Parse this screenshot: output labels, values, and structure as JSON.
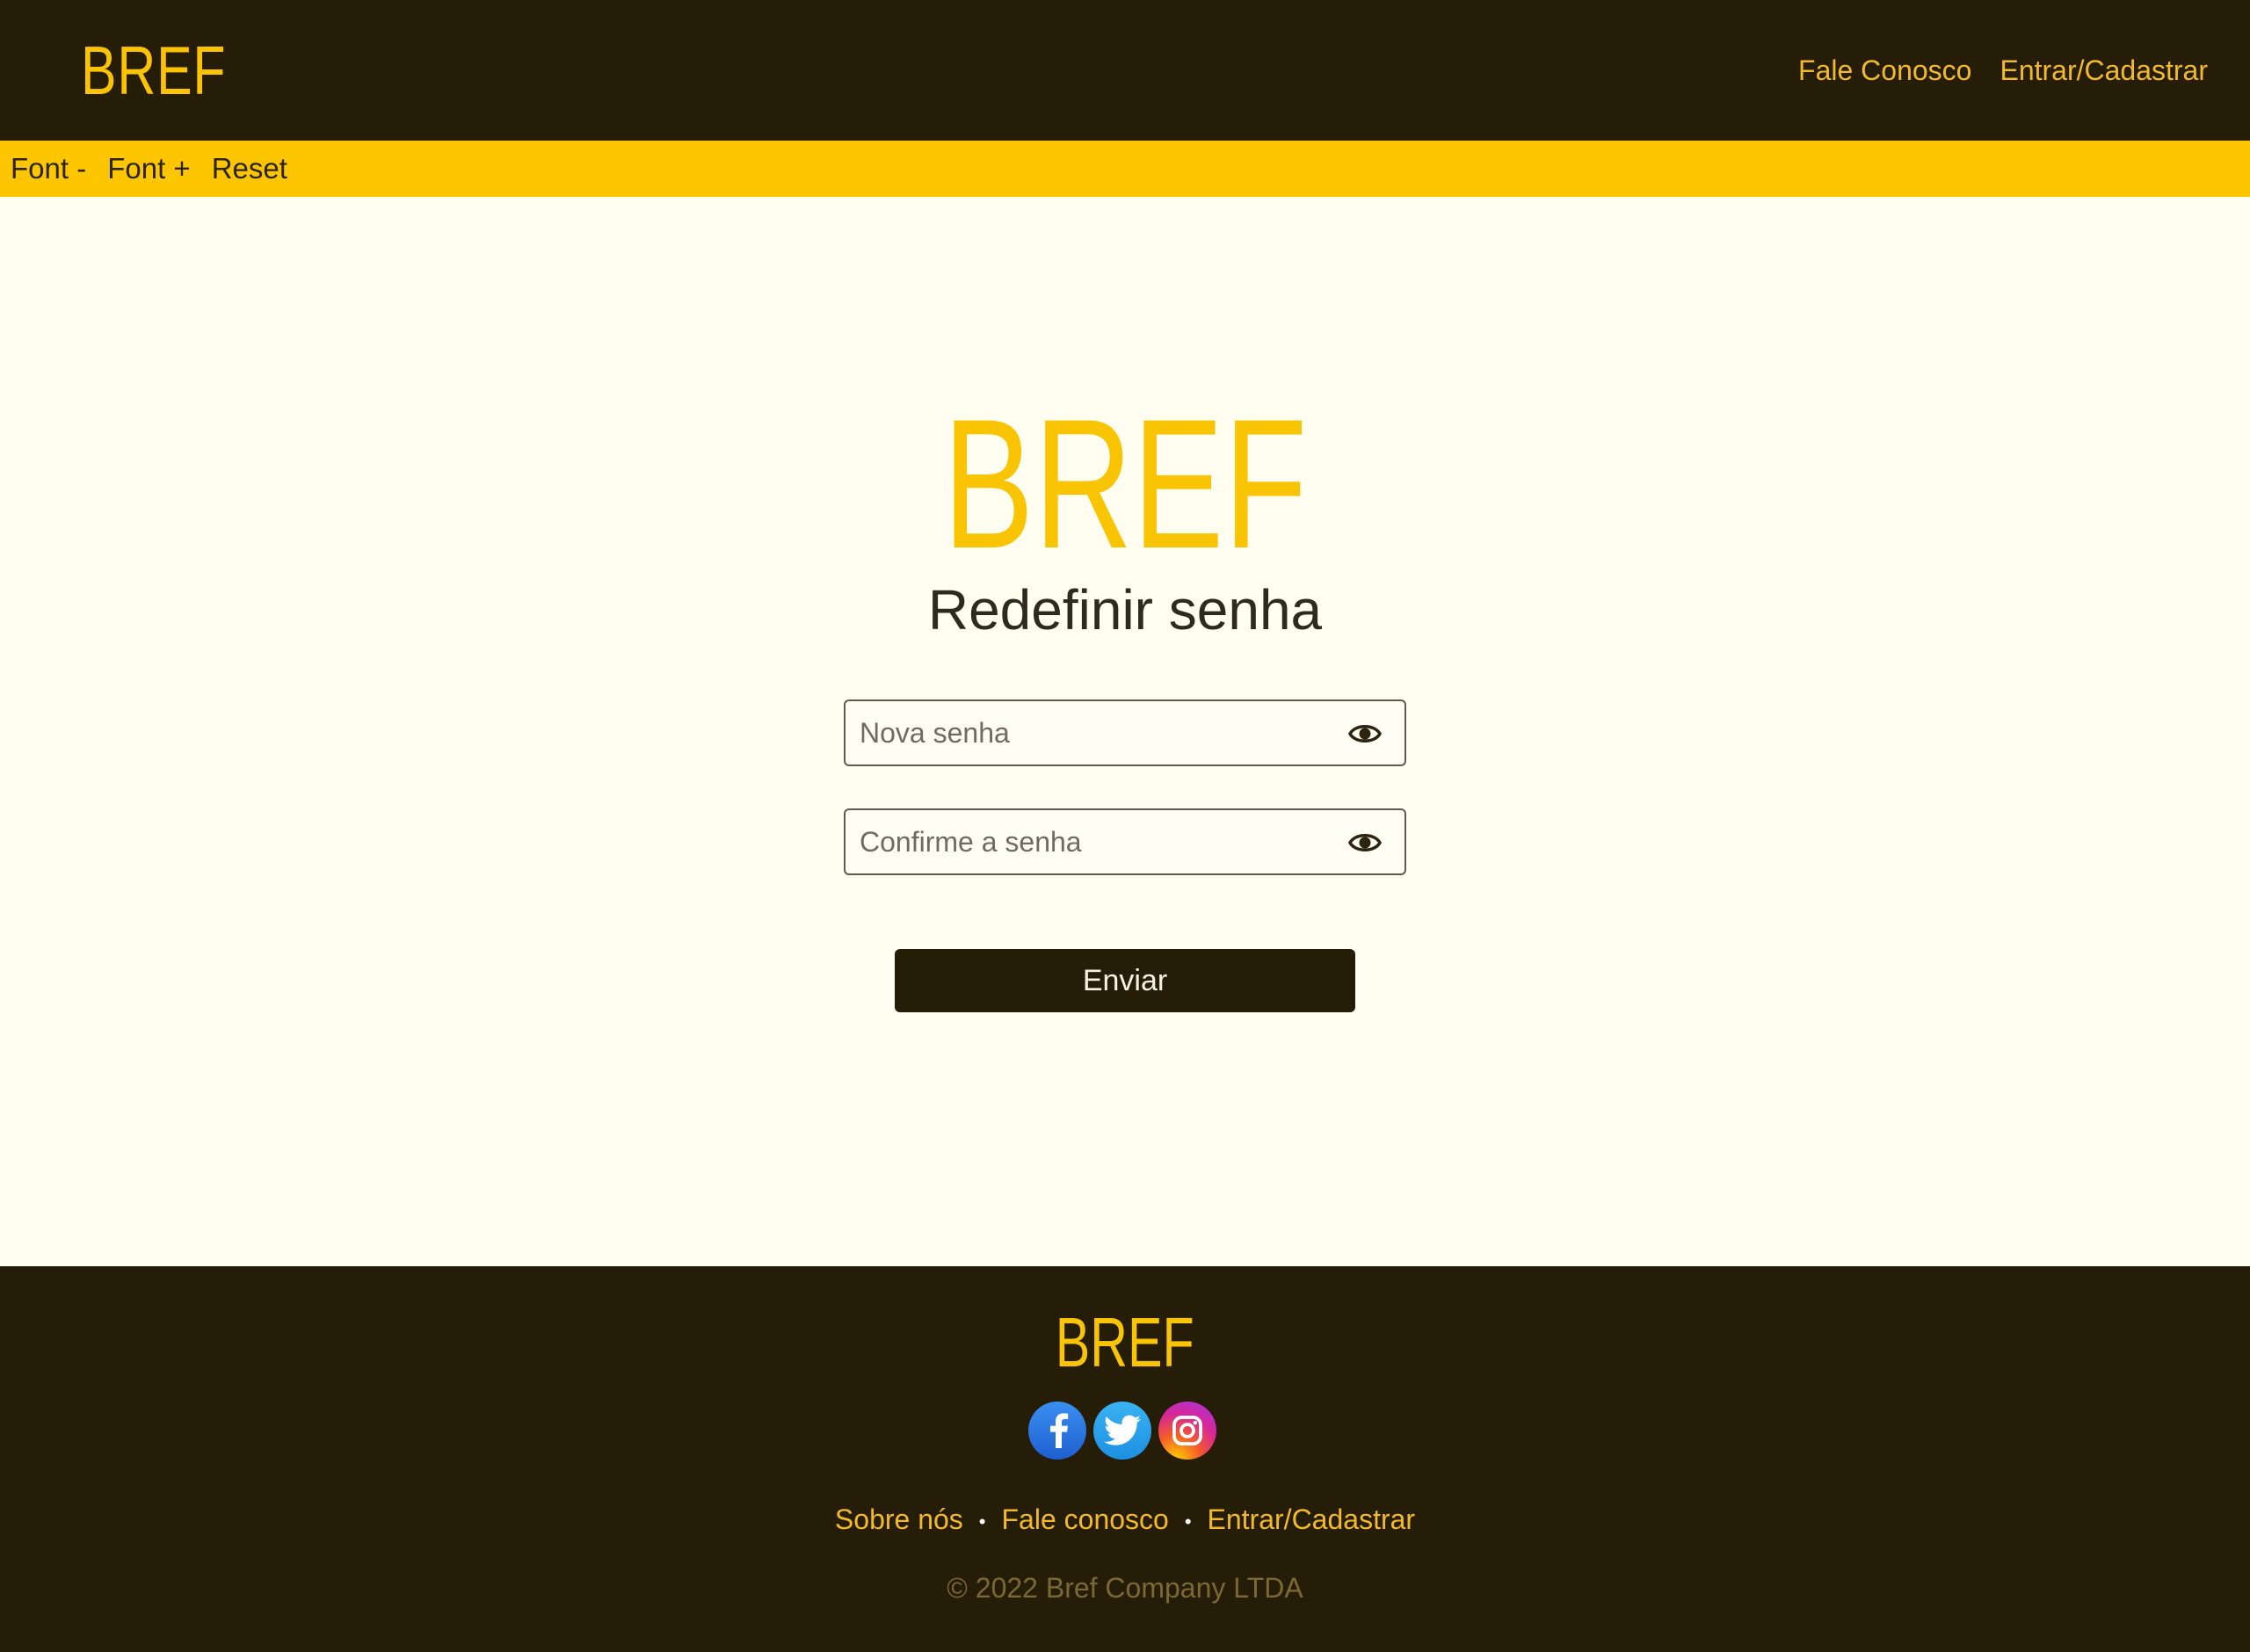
{
  "header": {
    "brand": "BREF",
    "nav": [
      "Fale Conosco",
      "Entrar/Cadastrar"
    ]
  },
  "accessibility_bar": {
    "font_minus": "Font -",
    "font_plus": "Font +",
    "reset": "Reset"
  },
  "main": {
    "logo": "BREF",
    "title": "Redefinir senha",
    "new_password_placeholder": "Nova senha",
    "confirm_password_placeholder": "Confirme a senha",
    "submit_label": "Enviar"
  },
  "footer": {
    "logo": "BREF",
    "socials": [
      "facebook-icon",
      "twitter-icon",
      "instagram-icon"
    ],
    "links": [
      "Sobre nós",
      "Fale conosco",
      "Entrar/Cadastrar"
    ],
    "copyright": "© 2022 Bref Company LTDA"
  },
  "colors": {
    "dark": "#261d09",
    "yellow": "#fcc300",
    "background": "#fffef1"
  }
}
